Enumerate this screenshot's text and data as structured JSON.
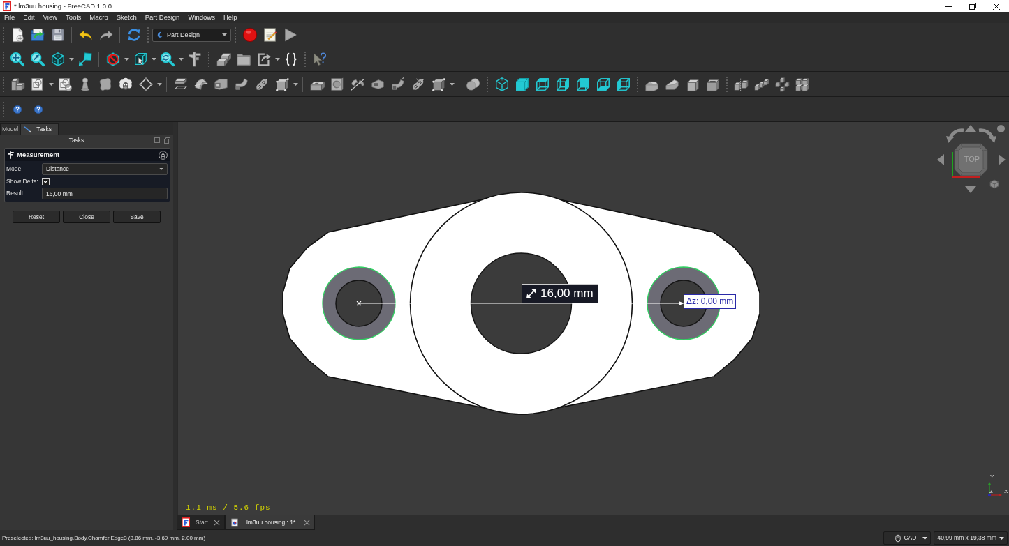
{
  "window": {
    "title": "* lm3uu housing - FreeCAD 1.0.0"
  },
  "menu": [
    "File",
    "Edit",
    "View",
    "Tools",
    "Macro",
    "Sketch",
    "Part Design",
    "Windows",
    "Help"
  ],
  "toolbar": {
    "workbench": "Part Design"
  },
  "panel": {
    "tabs": [
      {
        "label": "Model",
        "selected": false
      },
      {
        "label": "Tasks",
        "selected": true
      }
    ],
    "header": "Tasks",
    "task": {
      "title": "Measurement",
      "expanded": true,
      "fields": [
        {
          "kind": "select",
          "label": "Mode:",
          "value": "Distance"
        },
        {
          "kind": "checkbox",
          "label": "Show Delta:",
          "checked": true
        },
        {
          "kind": "text",
          "label": "Result:",
          "value": "16,00 mm"
        }
      ]
    },
    "buttons": [
      "Reset",
      "Close",
      "Save"
    ]
  },
  "viewport": {
    "dimension": "16,00 mm",
    "delta": "Δz: 0,00 mm",
    "navcube_face": "TOP",
    "fps": "1.1 ms / 5.6 fps",
    "axes": [
      "Y",
      "Z",
      "X"
    ]
  },
  "doc_tabs": [
    {
      "label": "Start",
      "selected": false
    },
    {
      "label": "lm3uu housing : 1*",
      "selected": true
    }
  ],
  "status_bar": {
    "message": "Preselected: lm3uu_housing.Body.Chamfer.Edge3 (8.86 mm, -3.69 mm, 2.00 mm)",
    "navigation": "CAD",
    "dimensions": "40,99 mm x 19,38 mm"
  }
}
